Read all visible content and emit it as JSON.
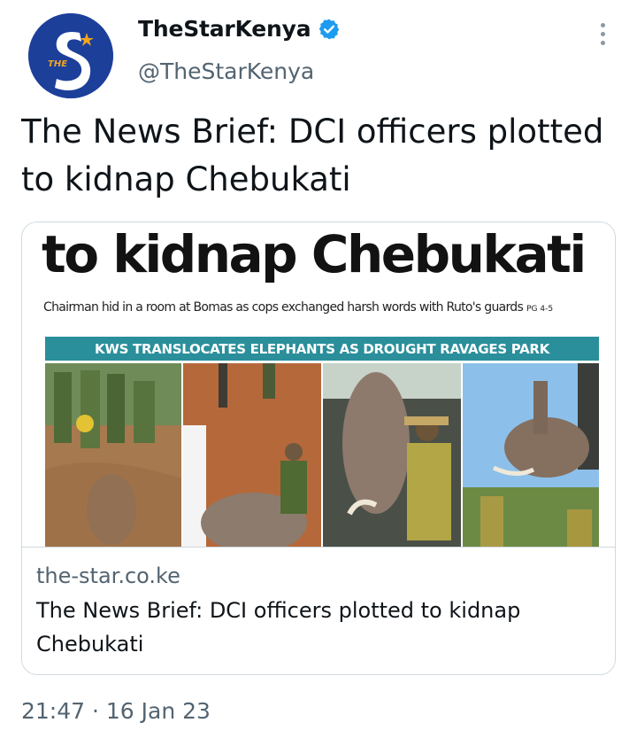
{
  "author": {
    "display_name": "TheStarKenya",
    "handle": "@TheStarKenya",
    "verified_icon": "verified-badge-icon",
    "avatar_text": "THE"
  },
  "tweet": {
    "text": "The News Brief: DCI officers plotted to kidnap Chebukati",
    "timestamp": "21:47 · 16 Jan 23"
  },
  "card": {
    "domain": "the-star.co.ke",
    "title": "The News Brief: DCI officers plotted to kidnap Chebukati",
    "newspaper": {
      "headline": "to kidnap Chebukati",
      "subheadline": "Chairman hid in a room at Bomas as cops exchanged harsh words with Ruto's guards",
      "page_ref": "PG 4-5",
      "banner": "KWS TRANSLOCATES ELEPHANTS AS DROUGHT RAVAGES PARK"
    }
  },
  "colors": {
    "brand_blue": "#1c3f9a",
    "verified_blue": "#1d9bf0",
    "banner_teal": "#2a8f9b",
    "secondary_text": "#536471"
  }
}
